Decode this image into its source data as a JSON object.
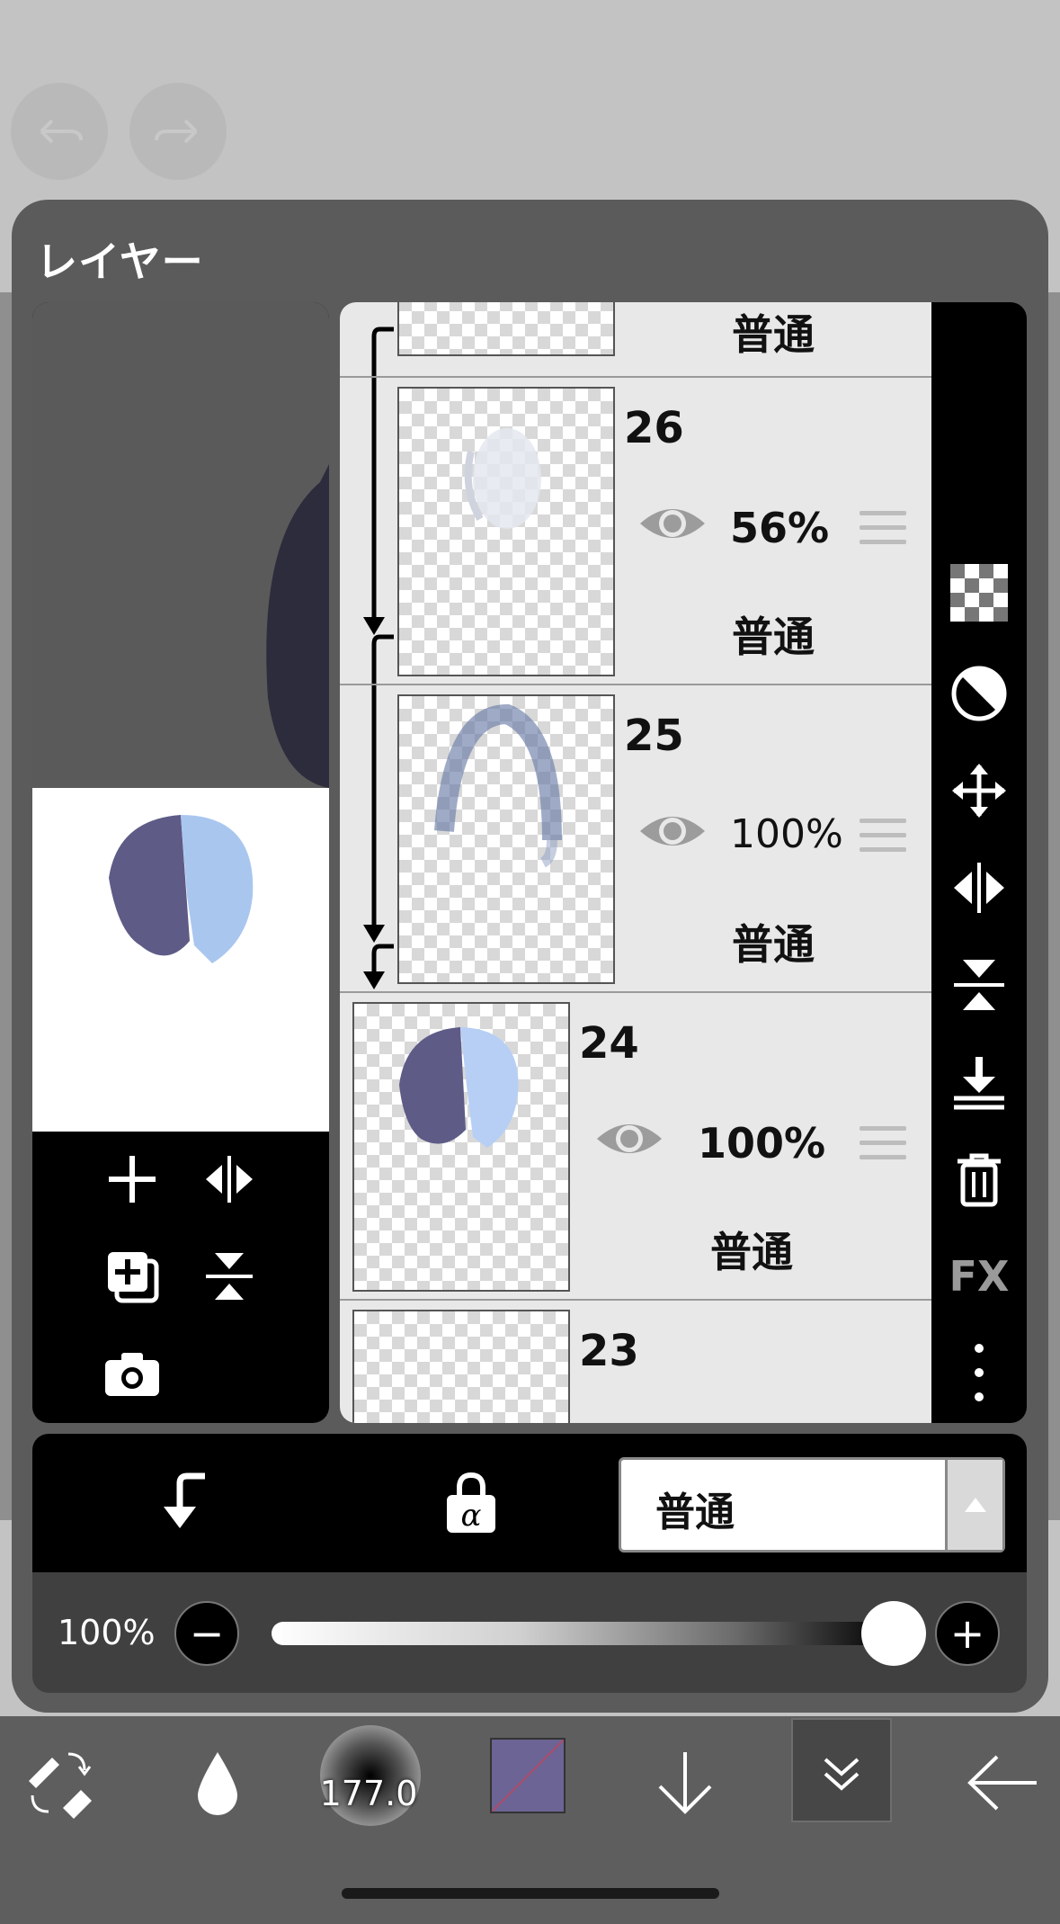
{
  "panel": {
    "title": "レイヤー"
  },
  "layers": [
    {
      "number": "",
      "opacity": "",
      "blend": "普通"
    },
    {
      "number": "26",
      "opacity": "56%",
      "blend": "普通"
    },
    {
      "number": "25",
      "opacity": "100%",
      "blend": "普通"
    },
    {
      "number": "24",
      "opacity": "100%",
      "blend": "普通"
    },
    {
      "number": "23",
      "opacity": "",
      "blend": ""
    }
  ],
  "side_toolbar": {
    "fx_label": "FX"
  },
  "controls": {
    "blend_mode": "普通",
    "opacity_label": "100%",
    "opacity_value": 1.0,
    "minus": "−",
    "plus": "+"
  },
  "bottom_toolbar": {
    "brush_size": "177.0",
    "color": "#6b6494"
  }
}
